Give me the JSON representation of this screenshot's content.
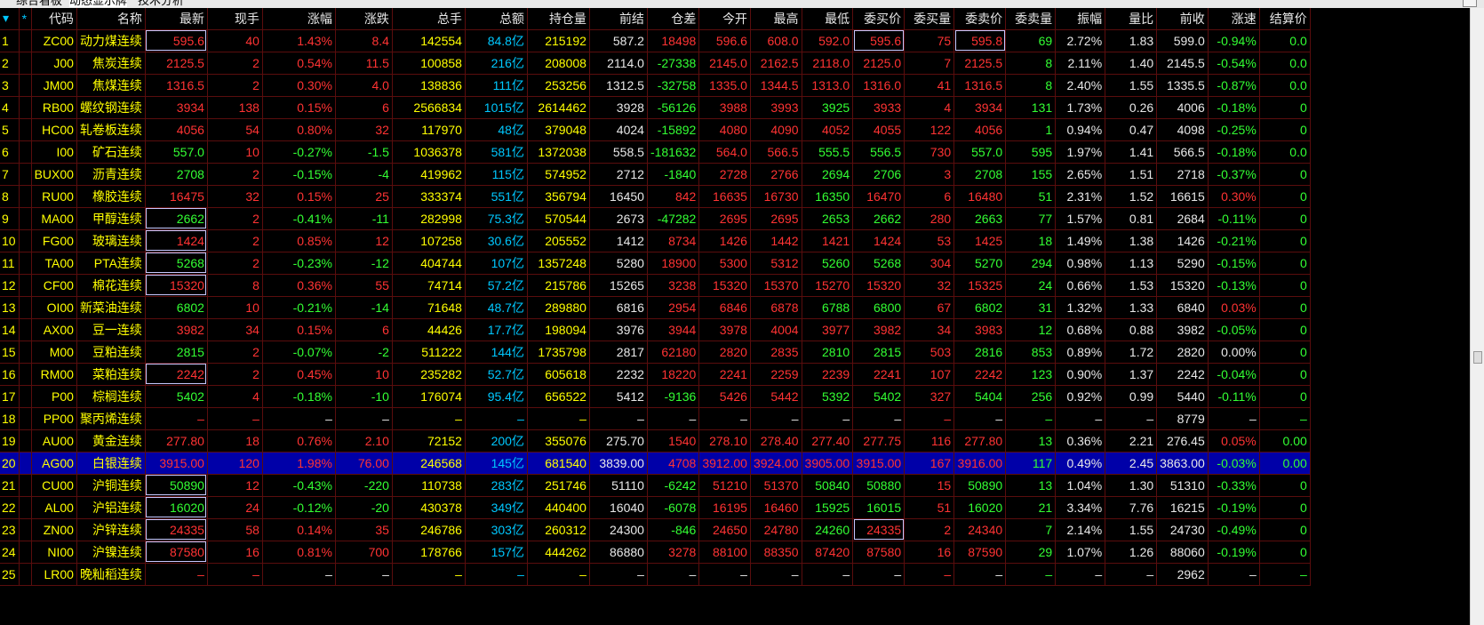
{
  "tabs": [
    {
      "label": "综合看板",
      "active": false
    },
    {
      "label": "动态显示牌",
      "active": true
    },
    {
      "label": "技术分析",
      "active": false
    }
  ],
  "columns": [
    "",
    "*",
    "代码",
    "名称",
    "最新",
    "现手",
    "涨幅",
    "涨跌",
    "总手",
    "总额",
    "持仓量",
    "前结",
    "仓差",
    "今开",
    "最高",
    "最低",
    "委买价",
    "委买量",
    "委卖价",
    "委卖量",
    "振幅",
    "量比",
    "前收",
    "涨速",
    "结算价"
  ],
  "selected_row": 20,
  "rows": [
    [
      "1",
      "",
      "ZC00",
      "动力煤连续",
      "595.6",
      "40",
      "1.43%",
      "8.4",
      "142554",
      "84.8亿",
      "215192",
      "587.2",
      "18498",
      "596.6",
      "608.0",
      "592.0",
      "595.6",
      "75",
      "595.8",
      "69",
      "2.72%",
      "1.83",
      "599.0",
      "-0.94%",
      "0.0"
    ],
    [
      "2",
      "",
      "J00",
      "焦炭连续",
      "2125.5",
      "2",
      "0.54%",
      "11.5",
      "100858",
      "216亿",
      "208008",
      "2114.0",
      "-27338",
      "2145.0",
      "2162.5",
      "2118.0",
      "2125.0",
      "7",
      "2125.5",
      "8",
      "2.11%",
      "1.40",
      "2145.5",
      "-0.54%",
      "0.0"
    ],
    [
      "3",
      "",
      "JM00",
      "焦煤连续",
      "1316.5",
      "2",
      "0.30%",
      "4.0",
      "138836",
      "111亿",
      "253256",
      "1312.5",
      "-32758",
      "1335.0",
      "1344.5",
      "1313.0",
      "1316.0",
      "41",
      "1316.5",
      "8",
      "2.40%",
      "1.55",
      "1335.5",
      "-0.87%",
      "0.0"
    ],
    [
      "4",
      "",
      "RB00",
      "螺纹钢连续",
      "3934",
      "138",
      "0.15%",
      "6",
      "2566834",
      "1015亿",
      "2614462",
      "3928",
      "-56126",
      "3988",
      "3993",
      "3925",
      "3933",
      "4",
      "3934",
      "131",
      "1.73%",
      "0.26",
      "4006",
      "-0.18%",
      "0"
    ],
    [
      "5",
      "",
      "HC00",
      "轧卷板连续",
      "4056",
      "54",
      "0.80%",
      "32",
      "117970",
      "48亿",
      "379048",
      "4024",
      "-15892",
      "4080",
      "4090",
      "4052",
      "4055",
      "122",
      "4056",
      "1",
      "0.94%",
      "0.47",
      "4098",
      "-0.25%",
      "0"
    ],
    [
      "6",
      "",
      "I00",
      "矿石连续",
      "557.0",
      "10",
      "-0.27%",
      "-1.5",
      "1036378",
      "581亿",
      "1372038",
      "558.5",
      "-181632",
      "564.0",
      "566.5",
      "555.5",
      "556.5",
      "730",
      "557.0",
      "595",
      "1.97%",
      "1.41",
      "566.5",
      "-0.18%",
      "0.0"
    ],
    [
      "7",
      "",
      "BUX00",
      "沥青连续",
      "2708",
      "2",
      "-0.15%",
      "-4",
      "419962",
      "115亿",
      "574952",
      "2712",
      "-1840",
      "2728",
      "2766",
      "2694",
      "2706",
      "3",
      "2708",
      "155",
      "2.65%",
      "1.51",
      "2718",
      "-0.37%",
      "0"
    ],
    [
      "8",
      "",
      "RU00",
      "橡胶连续",
      "16475",
      "32",
      "0.15%",
      "25",
      "333374",
      "551亿",
      "356794",
      "16450",
      "842",
      "16635",
      "16730",
      "16350",
      "16470",
      "6",
      "16480",
      "51",
      "2.31%",
      "1.52",
      "16615",
      "0.30%",
      "0"
    ],
    [
      "9",
      "",
      "MA00",
      "甲醇连续",
      "2662",
      "2",
      "-0.41%",
      "-11",
      "282998",
      "75.3亿",
      "570544",
      "2673",
      "-47282",
      "2695",
      "2695",
      "2653",
      "2662",
      "280",
      "2663",
      "77",
      "1.57%",
      "0.81",
      "2684",
      "-0.11%",
      "0"
    ],
    [
      "10",
      "",
      "FG00",
      "玻璃连续",
      "1424",
      "2",
      "0.85%",
      "12",
      "107258",
      "30.6亿",
      "205552",
      "1412",
      "8734",
      "1426",
      "1442",
      "1421",
      "1424",
      "53",
      "1425",
      "18",
      "1.49%",
      "1.38",
      "1426",
      "-0.21%",
      "0"
    ],
    [
      "11",
      "",
      "TA00",
      "PTA连续",
      "5268",
      "2",
      "-0.23%",
      "-12",
      "404744",
      "107亿",
      "1357248",
      "5280",
      "18900",
      "5300",
      "5312",
      "5260",
      "5268",
      "304",
      "5270",
      "294",
      "0.98%",
      "1.13",
      "5290",
      "-0.15%",
      "0"
    ],
    [
      "12",
      "",
      "CF00",
      "棉花连续",
      "15320",
      "8",
      "0.36%",
      "55",
      "74714",
      "57.2亿",
      "215786",
      "15265",
      "3238",
      "15320",
      "15370",
      "15270",
      "15320",
      "32",
      "15325",
      "24",
      "0.66%",
      "1.53",
      "15320",
      "-0.13%",
      "0"
    ],
    [
      "13",
      "",
      "OI00",
      "新菜油连续",
      "6802",
      "10",
      "-0.21%",
      "-14",
      "71648",
      "48.7亿",
      "289880",
      "6816",
      "2954",
      "6846",
      "6878",
      "6788",
      "6800",
      "67",
      "6802",
      "31",
      "1.32%",
      "1.33",
      "6840",
      "0.03%",
      "0"
    ],
    [
      "14",
      "",
      "AX00",
      "豆一连续",
      "3982",
      "34",
      "0.15%",
      "6",
      "44426",
      "17.7亿",
      "198094",
      "3976",
      "3944",
      "3978",
      "4004",
      "3977",
      "3982",
      "34",
      "3983",
      "12",
      "0.68%",
      "0.88",
      "3982",
      "-0.05%",
      "0"
    ],
    [
      "15",
      "",
      "M00",
      "豆粕连续",
      "2815",
      "2",
      "-0.07%",
      "-2",
      "511222",
      "144亿",
      "1735798",
      "2817",
      "62180",
      "2820",
      "2835",
      "2810",
      "2815",
      "503",
      "2816",
      "853",
      "0.89%",
      "1.72",
      "2820",
      "0.00%",
      "0"
    ],
    [
      "16",
      "",
      "RM00",
      "菜粕连续",
      "2242",
      "2",
      "0.45%",
      "10",
      "235282",
      "52.7亿",
      "605618",
      "2232",
      "18220",
      "2241",
      "2259",
      "2239",
      "2241",
      "107",
      "2242",
      "123",
      "0.90%",
      "1.37",
      "2242",
      "-0.04%",
      "0"
    ],
    [
      "17",
      "",
      "P00",
      "棕榈连续",
      "5402",
      "4",
      "-0.18%",
      "-10",
      "176074",
      "95.4亿",
      "656522",
      "5412",
      "-9136",
      "5426",
      "5442",
      "5392",
      "5402",
      "327",
      "5404",
      "256",
      "0.92%",
      "0.99",
      "5440",
      "-0.11%",
      "0"
    ],
    [
      "18",
      "",
      "PP00",
      "聚丙烯连续",
      "–",
      "–",
      "–",
      "–",
      "–",
      "–",
      "–",
      "–",
      "–",
      "–",
      "–",
      "–",
      "–",
      "–",
      "–",
      "–",
      "–",
      "–",
      "8779",
      "–",
      "–"
    ],
    [
      "19",
      "",
      "AU00",
      "黄金连续",
      "277.80",
      "18",
      "0.76%",
      "2.10",
      "72152",
      "200亿",
      "355076",
      "275.70",
      "1540",
      "278.10",
      "278.40",
      "277.40",
      "277.75",
      "116",
      "277.80",
      "13",
      "0.36%",
      "2.21",
      "276.45",
      "0.05%",
      "0.00"
    ],
    [
      "20",
      "",
      "AG00",
      "白银连续",
      "3915.00",
      "120",
      "1.98%",
      "76.00",
      "246568",
      "145亿",
      "681540",
      "3839.00",
      "4708",
      "3912.00",
      "3924.00",
      "3905.00",
      "3915.00",
      "167",
      "3916.00",
      "117",
      "0.49%",
      "2.45",
      "3863.00",
      "-0.03%",
      "0.00"
    ],
    [
      "21",
      "",
      "CU00",
      "沪铜连续",
      "50890",
      "12",
      "-0.43%",
      "-220",
      "110738",
      "283亿",
      "251746",
      "51110",
      "-6242",
      "51210",
      "51370",
      "50840",
      "50880",
      "15",
      "50890",
      "13",
      "1.04%",
      "1.30",
      "51310",
      "-0.33%",
      "0"
    ],
    [
      "22",
      "",
      "AL00",
      "沪铝连续",
      "16020",
      "24",
      "-0.12%",
      "-20",
      "430378",
      "349亿",
      "440400",
      "16040",
      "-6078",
      "16195",
      "16460",
      "15925",
      "16015",
      "51",
      "16020",
      "21",
      "3.34%",
      "7.76",
      "16215",
      "-0.19%",
      "0"
    ],
    [
      "23",
      "",
      "ZN00",
      "沪锌连续",
      "24335",
      "58",
      "0.14%",
      "35",
      "246786",
      "303亿",
      "260312",
      "24300",
      "-846",
      "24650",
      "24780",
      "24260",
      "24335",
      "2",
      "24340",
      "7",
      "2.14%",
      "1.55",
      "24730",
      "-0.49%",
      "0"
    ],
    [
      "24",
      "",
      "NI00",
      "沪镍连续",
      "87580",
      "16",
      "0.81%",
      "700",
      "178766",
      "157亿",
      "444262",
      "86880",
      "3278",
      "88100",
      "88350",
      "87420",
      "87580",
      "16",
      "87590",
      "29",
      "1.07%",
      "1.26",
      "88060",
      "-0.19%",
      "0"
    ],
    [
      "25",
      "",
      "LR00",
      "晚籼稻连续",
      "–",
      "–",
      "–",
      "–",
      "–",
      "–",
      "–",
      "–",
      "–",
      "–",
      "–",
      "–",
      "–",
      "–",
      "–",
      "–",
      "–",
      "–",
      "2962",
      "–",
      "–"
    ]
  ],
  "colors": {
    "up": "#ff3333",
    "down": "#33ff33",
    "neutral": "#e8e8e8",
    "amount": "#00c8ff",
    "label": "#ffff00",
    "selected_bg": "#0000a8"
  }
}
